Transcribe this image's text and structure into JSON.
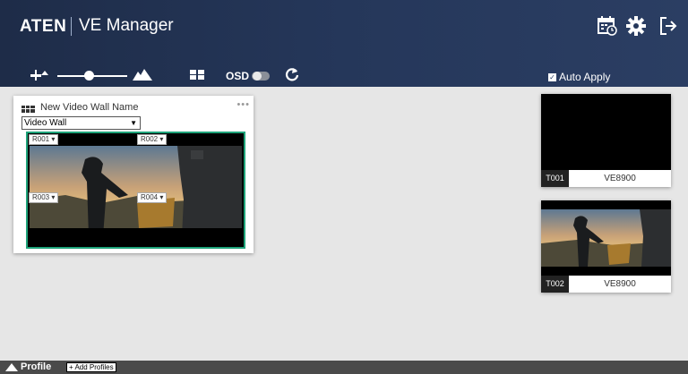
{
  "header": {
    "brand": "ATEN",
    "app_title": "VE Manager",
    "icons": [
      "schedule-calendar-icon",
      "settings-gear-icon",
      "logout-icon"
    ]
  },
  "toolbar": {
    "brightness_level": 0.45,
    "osd_label": "OSD",
    "osd_enabled": false,
    "auto_apply_label": "Auto Apply",
    "auto_apply_checked": true
  },
  "video_wall": {
    "name": "New Video Wall Name",
    "mode": "Video Wall",
    "receivers": [
      {
        "label": "R001"
      },
      {
        "label": "R002"
      },
      {
        "label": "R003"
      },
      {
        "label": "R004"
      }
    ]
  },
  "transmitters": [
    {
      "id": "T001",
      "model": "VE8900"
    },
    {
      "id": "T002",
      "model": "VE8900"
    }
  ],
  "footer": {
    "profile_label": "Profile",
    "add_profiles_label": "+ Add Profiles"
  },
  "colors": {
    "header_bg": "#25375a",
    "selection_border": "#1ea37a",
    "footer_bg": "#4a4a4a"
  }
}
